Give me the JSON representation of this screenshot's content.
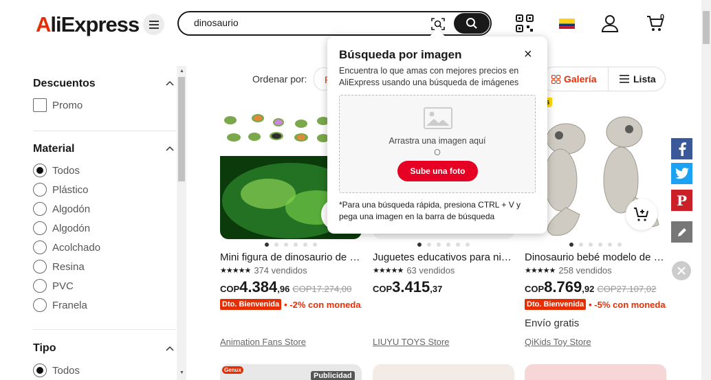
{
  "header": {
    "logo": "AliExpress",
    "search_value": "dinosaurio",
    "cart_count": "0",
    "colors": {
      "brand_red": "#e62e04",
      "dark": "#191919"
    }
  },
  "sidebar": {
    "discounts": {
      "title": "Descuentos",
      "options": [
        "Promo"
      ]
    },
    "material": {
      "title": "Material",
      "selected": "Todos",
      "options": [
        "Todos",
        "Plástico",
        "Algodón",
        "Algodón",
        "Acolchado",
        "Resina",
        "PVC",
        "Franela"
      ]
    },
    "type": {
      "title": "Tipo",
      "options": [
        "Todos"
      ]
    }
  },
  "toolbar": {
    "sort_label": "Ordenar por:",
    "gallery_label": "Galería",
    "list_label": "Lista"
  },
  "popover": {
    "title": "Búsqueda por imagen",
    "description": "Encuentra lo que amas con mejores precios en AliExpress usando una búsqueda de imágenes",
    "drop_text": "Arrastra una imagen aquí",
    "or_text": "O",
    "upload_label": "Sube una foto",
    "footer": "*Para una búsqueda rápida, presiona CTRL + V y pega una imagen en la barra de búsqueda"
  },
  "products": [
    {
      "title": "Mini figura de dinosaurio de g...",
      "stars": "★★★★★",
      "sold": "374 vendidos",
      "currency": "COP",
      "price_int": "4.384",
      "price_dec": ",96",
      "price_old": "COP17.274,00",
      "promo_tag": "Dto. Bienvenida",
      "promo_text": "• -2% con moneda...",
      "shipping": "",
      "store": "Animation Fans Store"
    },
    {
      "title": "Juguetes educativos para niño...",
      "stars": "★★★★★",
      "sold": "63 vendidos",
      "currency": "COP",
      "price_int": "3.415",
      "price_dec": ",37",
      "price_old": "",
      "promo_tag": "",
      "promo_text": "",
      "shipping": "",
      "store": "LIUYU TOYS Store"
    },
    {
      "title": "Dinosaurio bebé modelo de si...",
      "stars": "★★★★★",
      "sold": "258 vendidos",
      "currency": "COP",
      "price_int": "8.769",
      "price_dec": ",92",
      "price_old": "COP27.107,02",
      "promo_tag": "Dto. Bienvenida",
      "promo_text": "• -5% con moneda...",
      "shipping": "Envío gratis",
      "store": "QiKids Toy Store"
    }
  ],
  "badges": {
    "third_product_corner": "ás",
    "next_row_label": "Publicidad",
    "next_row_brand": "Genux"
  },
  "share": [
    "facebook-icon",
    "twitter-icon",
    "pinterest-icon",
    "edit-icon",
    "close-icon"
  ]
}
